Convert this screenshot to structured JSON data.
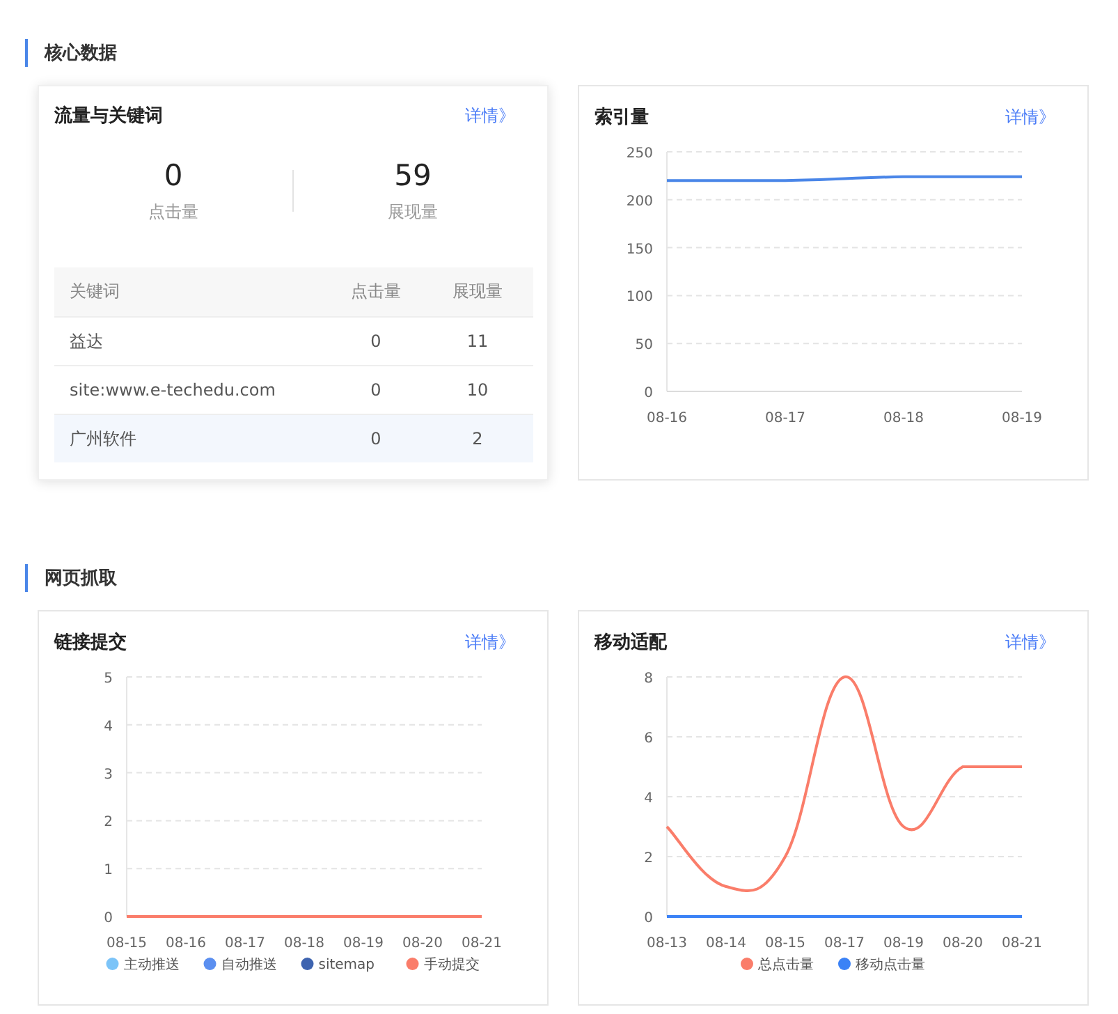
{
  "sections": [
    {
      "title": "核心数据",
      "cards": [
        {
          "kind": "keywords",
          "title": "流量与关键词",
          "link": "详情》",
          "elevated": true,
          "stats": [
            {
              "value": "0",
              "label": "点击量"
            },
            {
              "value": "59",
              "label": "展现量"
            }
          ],
          "table": {
            "columns": [
              "关键词",
              "点击量",
              "展现量"
            ],
            "rows": [
              {
                "cells": [
                  "益达",
                  "0",
                  "11"
                ],
                "selected": false
              },
              {
                "cells": [
                  "site:www.e-techedu.com",
                  "0",
                  "10"
                ],
                "selected": false
              },
              {
                "cells": [
                  "广州软件",
                  "0",
                  "2"
                ],
                "selected": true
              }
            ]
          }
        },
        {
          "kind": "chart",
          "title": "索引量",
          "link": "详情》",
          "elevated": false,
          "chart_data": {
            "type": "line",
            "categories": [
              "08-16",
              "08-17",
              "08-18",
              "08-19"
            ],
            "series": [
              {
                "color": "#4a86e8",
                "values": [
                  220,
                  220,
                  224,
                  224
                ]
              }
            ],
            "ylim": [
              0,
              250
            ],
            "yticks": [
              {
                "value": 0,
                "label": "0"
              },
              {
                "value": 50,
                "label": "50"
              },
              {
                "value": 100,
                "label": "100"
              },
              {
                "value": 150,
                "label": "150"
              },
              {
                "value": 200,
                "label": "200"
              },
              {
                "value": 250,
                "label": "250"
              }
            ],
            "grid": true
          }
        }
      ]
    },
    {
      "title": "网页抓取",
      "cards": [
        {
          "kind": "chart",
          "title": "链接提交",
          "link": "详情》",
          "elevated": false,
          "chart_data": {
            "type": "line",
            "categories": [
              "08-15",
              "08-16",
              "08-17",
              "08-18",
              "08-19",
              "08-20",
              "08-21"
            ],
            "series": [
              {
                "name": "主动推送",
                "color": "#7cc4f8",
                "values": [
                  null,
                  null,
                  null,
                  null,
                  null,
                  null,
                  null
                ]
              },
              {
                "name": "自动推送",
                "color": "#5b8ff0",
                "values": [
                  null,
                  null,
                  null,
                  null,
                  null,
                  null,
                  null
                ]
              },
              {
                "name": "sitemap",
                "color": "#3e64b0",
                "values": [
                  null,
                  null,
                  null,
                  null,
                  null,
                  null,
                  null
                ]
              },
              {
                "name": "手动提交",
                "color": "#fa7d6a",
                "values": [
                  0,
                  0,
                  0,
                  0,
                  0,
                  0,
                  0
                ]
              }
            ],
            "ylim": [
              0,
              5
            ],
            "yticks": [
              {
                "value": 0,
                "label": "0"
              },
              {
                "value": 1,
                "label": "1"
              },
              {
                "value": 2,
                "label": "2"
              },
              {
                "value": 3,
                "label": "3"
              },
              {
                "value": 4,
                "label": "4"
              },
              {
                "value": 5,
                "label": "5"
              }
            ],
            "grid": true,
            "legend": "bottom"
          }
        },
        {
          "kind": "chart",
          "title": "移动适配",
          "link": "详情》",
          "elevated": false,
          "chart_data": {
            "type": "line",
            "categories": [
              "08-13",
              "08-14",
              "08-15",
              "08-17",
              "08-19",
              "08-20",
              "08-21"
            ],
            "series": [
              {
                "name": "总点击量",
                "color": "#fa7d6a",
                "values": [
                  3,
                  1,
                  2,
                  8,
                  3,
                  5,
                  5
                ]
              },
              {
                "name": "移动点击量",
                "color": "#3b82f6",
                "values": [
                  0,
                  0,
                  0,
                  0,
                  0,
                  0,
                  0
                ]
              }
            ],
            "ylim": [
              0,
              8
            ],
            "yticks": [
              {
                "value": 0,
                "label": "0"
              },
              {
                "value": 2,
                "label": "2"
              },
              {
                "value": 4,
                "label": "4"
              },
              {
                "value": 6,
                "label": "6"
              },
              {
                "value": 8,
                "label": "8"
              }
            ],
            "grid": true,
            "legend": "bottom"
          }
        }
      ]
    }
  ]
}
